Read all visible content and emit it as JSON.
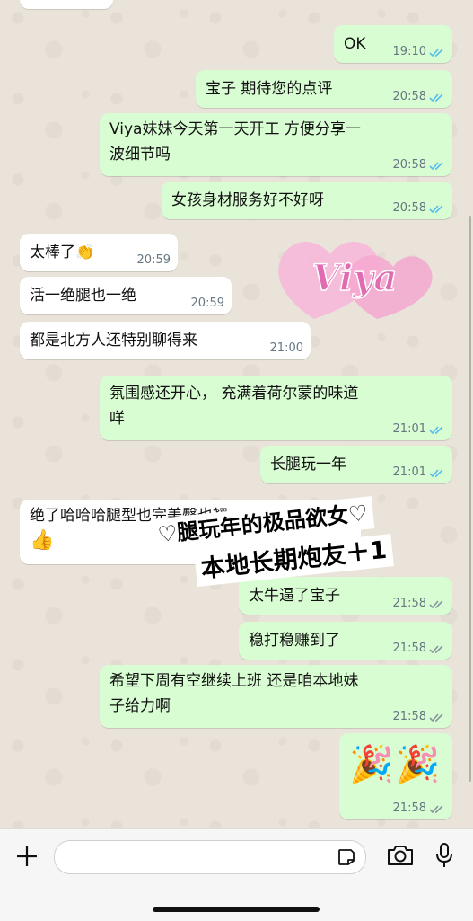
{
  "messages": [
    {
      "text": "OK",
      "time": "19:10"
    },
    {
      "text": "宝子 期待您的点评",
      "time": "20:58"
    },
    {
      "line1": "Viya妹妹今天第一天开工 方便分享一",
      "line2": "波细节吗",
      "time": "20:58"
    },
    {
      "text": "女孩身材服务好不好呀",
      "time": "20:58"
    },
    {
      "text": "太棒了👏",
      "time": "20:59"
    },
    {
      "text": "活一绝腿也一绝",
      "time": "20:59"
    },
    {
      "text": "都是北方人还特别聊得来",
      "time": "21:00"
    },
    {
      "line1": "氛围感还开心， 充满着荷尔蒙的味道",
      "line2": "咩",
      "time": "21:01"
    },
    {
      "text": "长腿玩一年",
      "time": "21:01"
    },
    {
      "line1": "绝了哈哈哈腿型也完美臀也翘",
      "line2": "👍"
    },
    {
      "text": "太牛逼了宝子",
      "time": "21:58"
    },
    {
      "text": "稳打稳赚到了",
      "time": "21:58"
    },
    {
      "line1": "希望下周有空继续上班 还是咱本地妹",
      "line2": "子给力啊",
      "time": "21:58"
    },
    {
      "text": "🎉🎉",
      "time": "21:58"
    }
  ],
  "sticker": {
    "text": "Viya"
  },
  "overlay": {
    "line1": "♡腿玩年的极品欲女♡",
    "line2": "本地长期炮友＋1"
  },
  "colors": {
    "outgoing": "#d9fdd3",
    "incoming": "#ffffff",
    "read_tick": "#53bdeb",
    "sent_tick": "#8696a0"
  }
}
